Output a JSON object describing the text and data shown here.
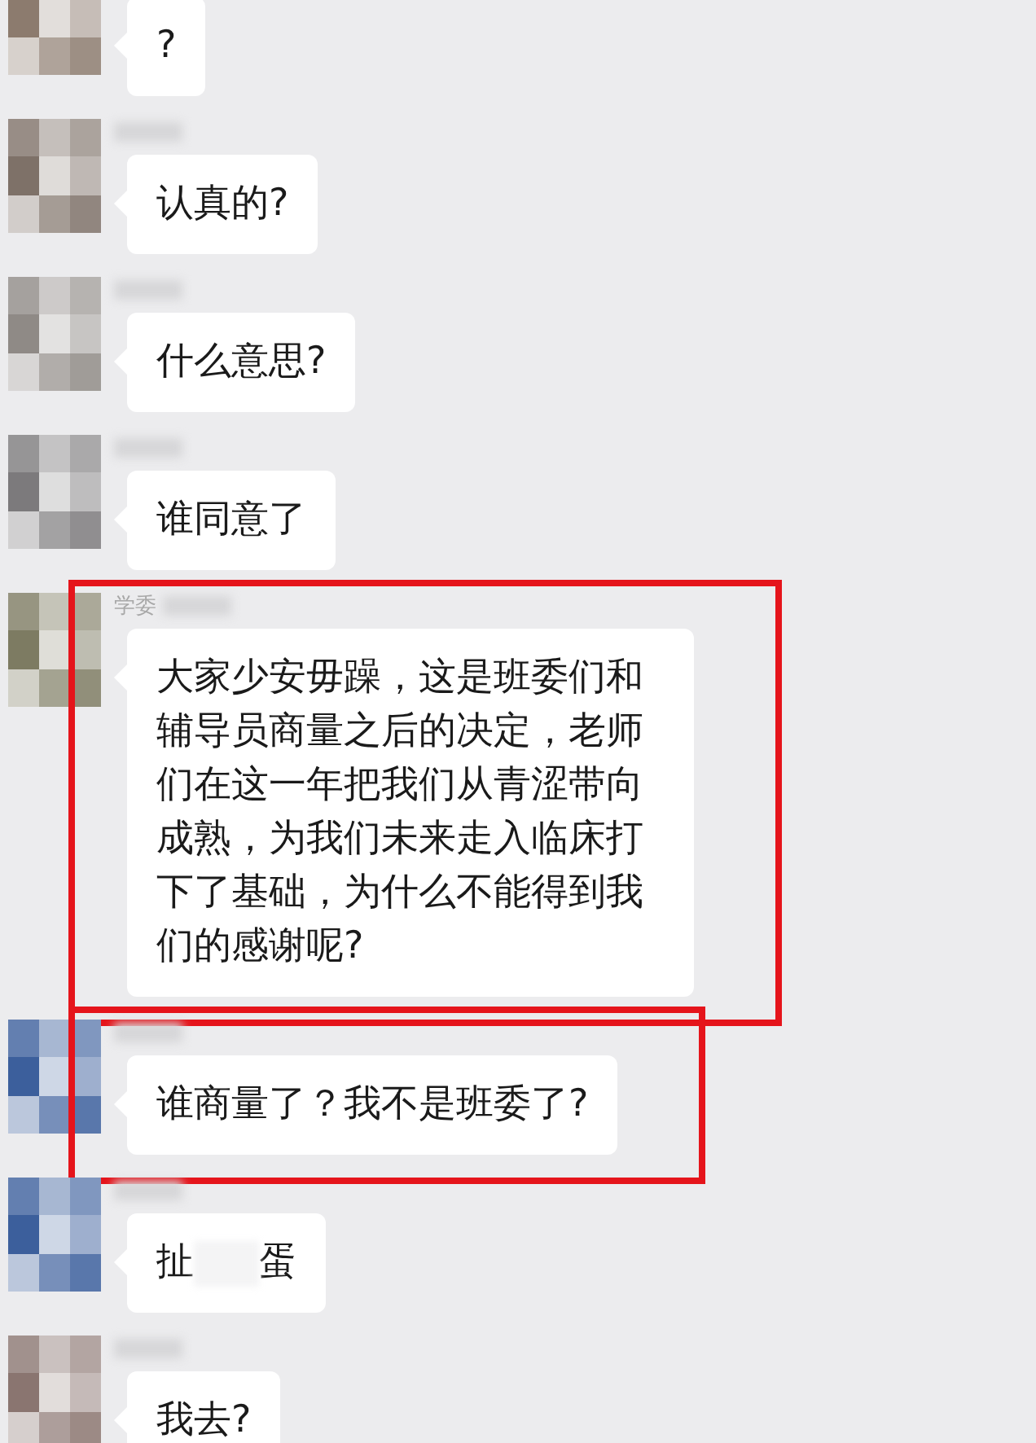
{
  "messages": [
    {
      "avatar": {
        "color": "#8c7b6e"
      },
      "text_parts": [
        "?"
      ],
      "highlighted": false
    },
    {
      "avatar": {
        "color": "#7e7168"
      },
      "name_blurred": true,
      "text_parts": [
        "认真的?"
      ],
      "highlighted": false
    },
    {
      "avatar": {
        "color": "#8f8a86"
      },
      "name_blurred": true,
      "text_parts": [
        "什么意思?"
      ],
      "highlighted": false
    },
    {
      "avatar": {
        "color": "#7c7a7c"
      },
      "name_blurred": true,
      "text_parts": [
        "谁同意了"
      ],
      "highlighted": false
    },
    {
      "avatar": {
        "color": "#7d7b62"
      },
      "name": "学委",
      "name_blurred": true,
      "text_parts": [
        "大家少安毋躁，这是班委们和辅导员商量之后的决定，老师们在这一年把我们从青涩带向成熟，为我们未来走入临床打下了基础，为什么不能得到我们的感谢呢?"
      ],
      "highlighted": true
    },
    {
      "avatar": {
        "color": "#3c5f9c"
      },
      "name_blurred": true,
      "text_parts": [
        "谁商量了？我不是班委了?"
      ],
      "highlighted": true
    },
    {
      "avatar": {
        "color": "#3c5f9c"
      },
      "name_blurred": true,
      "text_parts": [
        "扯",
        "蛋"
      ],
      "highlighted": false
    },
    {
      "avatar": {
        "color": "#8a7570"
      },
      "name_blurred": true,
      "text_parts": [
        "我去?"
      ],
      "highlighted": false
    }
  ]
}
